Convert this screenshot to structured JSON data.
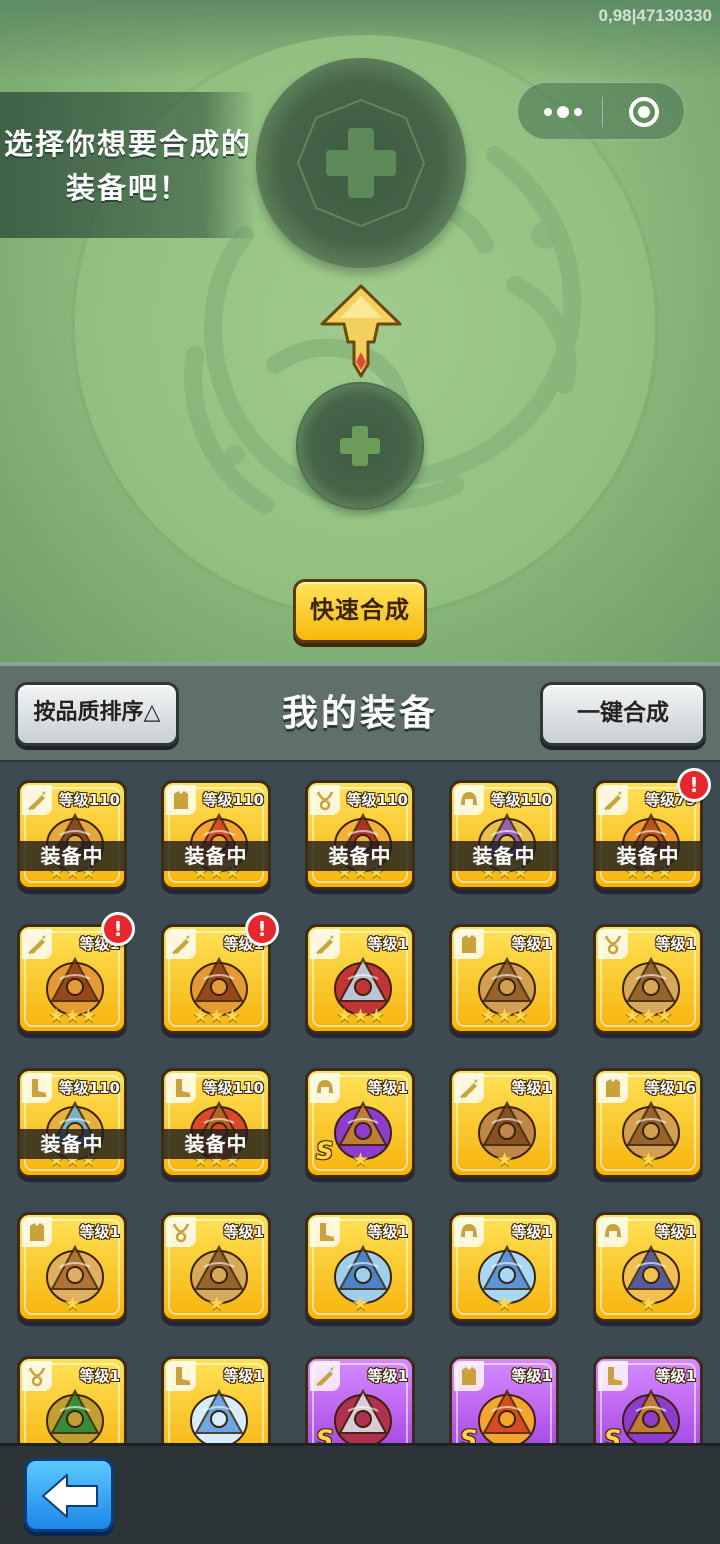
{
  "debug": {
    "text": "0,98|47130330"
  },
  "capsule": {
    "more_icon": "more-dots-icon",
    "close_icon": "target-close-icon"
  },
  "hint": {
    "text": "选择你想要合成的装备吧！"
  },
  "forge": {
    "main_slot_icon": "plus-icon",
    "sub_slot_icon": "plus-icon",
    "arrow_icon": "up-arrow-icon",
    "quick_button": "快速合成"
  },
  "header": {
    "sort_button": "按品质排序△",
    "title": "我的装备",
    "merge_all_button": "一键合成"
  },
  "equipment": {
    "equipped_label": "装备中",
    "items": [
      {
        "slot": "sword",
        "level": "等级110",
        "equipped": true,
        "stars": 3,
        "rarity": "gold",
        "item": "golden blade",
        "alert": false
      },
      {
        "slot": "armor",
        "level": "等级110",
        "equipped": true,
        "stars": 3,
        "rarity": "gold",
        "item": "flame armor",
        "alert": false
      },
      {
        "slot": "necklace",
        "level": "等级110",
        "equipped": true,
        "stars": 3,
        "rarity": "gold",
        "item": "ruby amulet",
        "alert": false
      },
      {
        "slot": "helmet",
        "level": "等级110",
        "equipped": true,
        "stars": 3,
        "rarity": "gold",
        "item": "winged helm",
        "alert": false
      },
      {
        "slot": "sword",
        "level": "等级75",
        "equipped": true,
        "stars": 3,
        "rarity": "gold",
        "item": "dragon blade",
        "alert": true
      },
      {
        "slot": "sword",
        "level": "等级1",
        "equipped": false,
        "stars": 3,
        "rarity": "gold",
        "item": "dragon staff",
        "alert": true
      },
      {
        "slot": "sword",
        "level": "等级1",
        "equipped": false,
        "stars": 3,
        "rarity": "gold",
        "item": "dragon staff",
        "alert": true
      },
      {
        "slot": "sword",
        "level": "等级1",
        "equipped": false,
        "stars": 3,
        "rarity": "gold",
        "item": "curved sabre",
        "alert": false
      },
      {
        "slot": "armor",
        "level": "等级1",
        "equipped": false,
        "stars": 3,
        "rarity": "gold",
        "item": "bronze armor",
        "alert": false
      },
      {
        "slot": "necklace",
        "level": "等级1",
        "equipped": false,
        "stars": 3,
        "rarity": "gold",
        "item": "bronze amulet",
        "alert": false
      },
      {
        "slot": "boots",
        "level": "等级110",
        "equipped": true,
        "stars": 3,
        "rarity": "gold",
        "item": "gem crown",
        "alert": false
      },
      {
        "slot": "boots",
        "level": "等级110",
        "equipped": true,
        "stars": 3,
        "rarity": "gold",
        "item": "gold boots",
        "alert": false
      },
      {
        "slot": "helmet",
        "level": "等级1",
        "equipped": false,
        "stars": 1,
        "rarity": "gold",
        "item": "gold helm",
        "alert": false,
        "rank": "S"
      },
      {
        "slot": "sword",
        "level": "等级1",
        "equipped": false,
        "stars": 1,
        "rarity": "gold",
        "item": "crossbow",
        "alert": false
      },
      {
        "slot": "armor",
        "level": "等级16",
        "equipped": false,
        "stars": 1,
        "rarity": "gold",
        "item": "bronze armor",
        "alert": false
      },
      {
        "slot": "armor",
        "level": "等级1",
        "equipped": false,
        "stars": 1,
        "rarity": "gold",
        "item": "tan armor",
        "alert": false
      },
      {
        "slot": "necklace",
        "level": "等级1",
        "equipped": false,
        "stars": 1,
        "rarity": "gold",
        "item": "bronze amulet",
        "alert": false
      },
      {
        "slot": "boots",
        "level": "等级1",
        "equipped": false,
        "stars": 1,
        "rarity": "gold",
        "item": "blue gauntlet",
        "alert": false
      },
      {
        "slot": "helmet",
        "level": "等级1",
        "equipped": false,
        "stars": 1,
        "rarity": "gold",
        "item": "blue sword",
        "alert": false
      },
      {
        "slot": "helmet",
        "level": "等级1",
        "equipped": false,
        "stars": 1,
        "rarity": "gold",
        "item": "blue helm",
        "alert": false
      },
      {
        "slot": "necklace",
        "level": "等级1",
        "equipped": false,
        "stars": 0,
        "rarity": "gold",
        "item": "jade amulet",
        "alert": false
      },
      {
        "slot": "boots",
        "level": "等级1",
        "equipped": false,
        "stars": 0,
        "rarity": "gold",
        "item": "ice boots",
        "alert": false
      },
      {
        "slot": "sword",
        "level": "等级1",
        "equipped": false,
        "stars": 0,
        "rarity": "purple",
        "item": "ornate blade",
        "alert": false,
        "rank": "S"
      },
      {
        "slot": "armor",
        "level": "等级1",
        "equipped": false,
        "stars": 0,
        "rarity": "purple",
        "item": "flame armor",
        "alert": false,
        "rank": "S"
      },
      {
        "slot": "boots",
        "level": "等级1",
        "equipped": false,
        "stars": 0,
        "rarity": "purple",
        "item": "gold helm",
        "alert": false,
        "rank": "S"
      }
    ]
  },
  "bottom": {
    "back_icon": "back-arrow-icon"
  },
  "colors": {
    "gold_card": "#f6b40c",
    "purple_card": "#9f3fe2",
    "alert": "#e8262b",
    "back_button": "#1b86e8"
  }
}
